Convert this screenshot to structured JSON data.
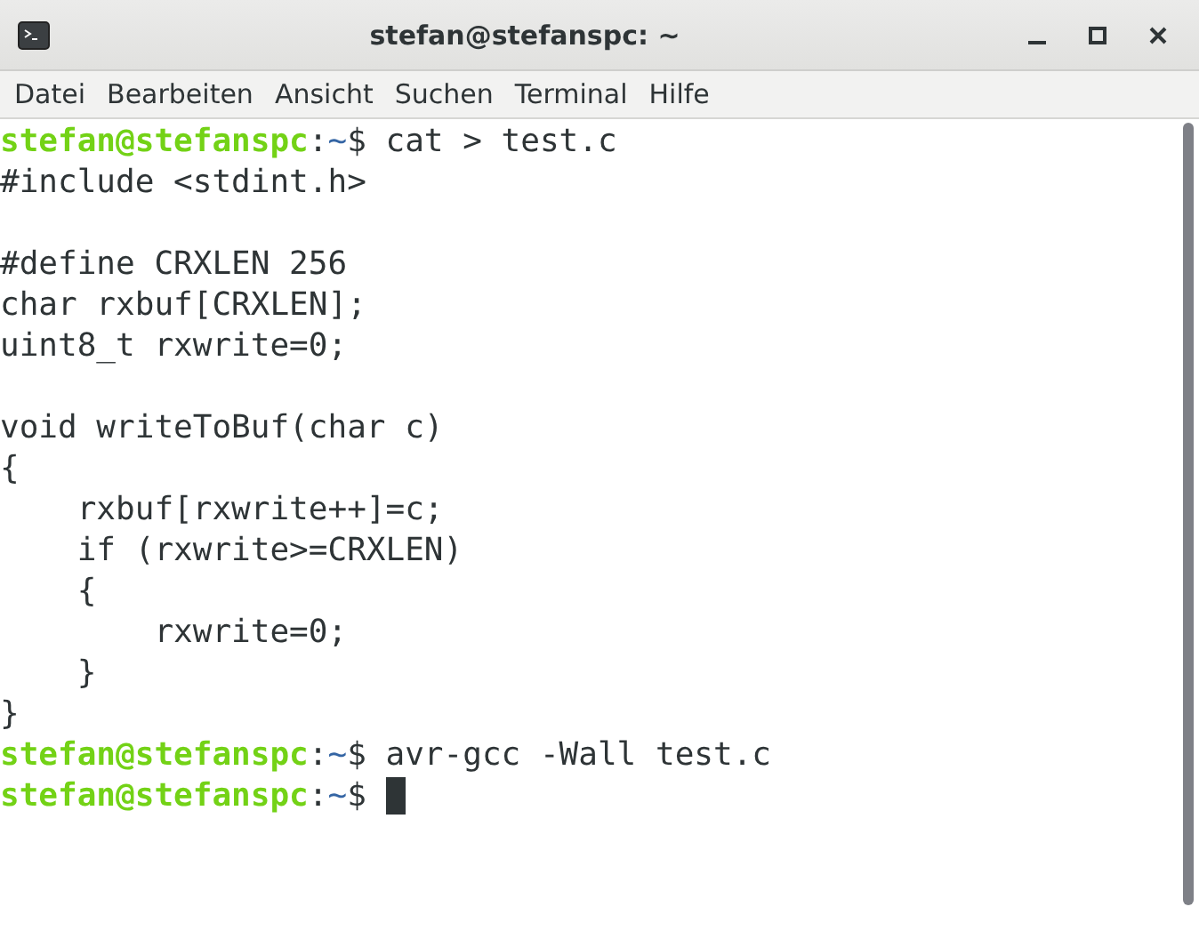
{
  "window": {
    "title": "stefan@stefanspc: ~"
  },
  "menu": [
    "Datei",
    "Bearbeiten",
    "Ansicht",
    "Suchen",
    "Terminal",
    "Hilfe"
  ],
  "terminal": {
    "lines": [
      {
        "kind": "prompt",
        "user": "stefan@stefanspc",
        "separator": ":",
        "path": "~",
        "symbol": "$",
        "command": "cat > test.c",
        "cursor": false
      },
      {
        "kind": "output",
        "text": "#include <stdint.h>"
      },
      {
        "kind": "blank"
      },
      {
        "kind": "output",
        "text": "#define CRXLEN 256"
      },
      {
        "kind": "output",
        "text": "char rxbuf[CRXLEN];"
      },
      {
        "kind": "output",
        "text": "uint8_t rxwrite=0;"
      },
      {
        "kind": "blank"
      },
      {
        "kind": "output",
        "text": "void writeToBuf(char c)"
      },
      {
        "kind": "output",
        "text": "{"
      },
      {
        "kind": "output",
        "text": "    rxbuf[rxwrite++]=c;"
      },
      {
        "kind": "output",
        "text": "    if (rxwrite>=CRXLEN)"
      },
      {
        "kind": "output",
        "text": "    {"
      },
      {
        "kind": "output",
        "text": "        rxwrite=0;"
      },
      {
        "kind": "output",
        "text": "    }"
      },
      {
        "kind": "output",
        "text": "}"
      },
      {
        "kind": "prompt",
        "user": "stefan@stefanspc",
        "separator": ":",
        "path": "~",
        "symbol": "$",
        "command": "avr-gcc -Wall test.c",
        "cursor": false
      },
      {
        "kind": "prompt",
        "user": "stefan@stefanspc",
        "separator": ":",
        "path": "~",
        "symbol": "$",
        "cursor": true
      }
    ]
  }
}
